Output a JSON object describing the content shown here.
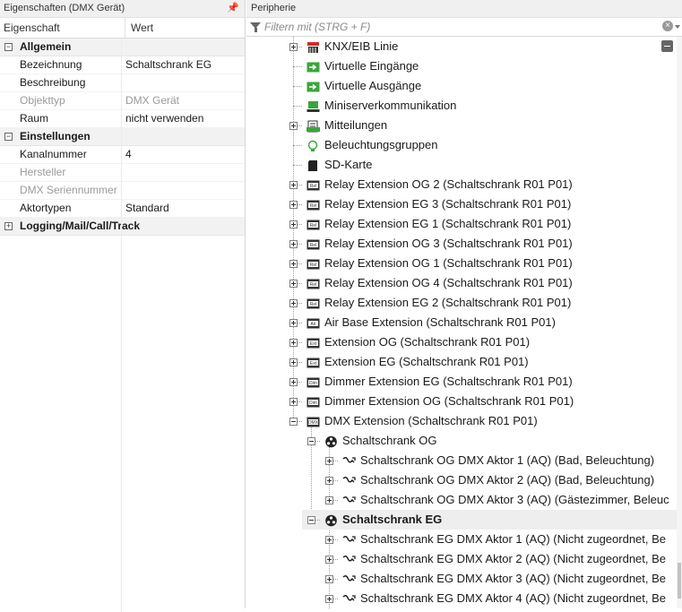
{
  "left_panel": {
    "title": "Eigenschaften (DMX Gerät)",
    "pin_glyph": "📌",
    "header": {
      "col1": "Eigenschaft",
      "col2": "Wert"
    },
    "categories": [
      {
        "label": "Allgemein",
        "exp": "−"
      },
      {
        "label": "Einstellungen",
        "exp": "−"
      },
      {
        "label": "Logging/Mail/Call/Track",
        "exp": "+"
      }
    ],
    "rows": {
      "bezeichnung": {
        "label": "Bezeichnung",
        "value": "Schaltschrank EG"
      },
      "beschreibung": {
        "label": "Beschreibung",
        "value": ""
      },
      "objekttyp": {
        "label": "Objekttyp",
        "value": "DMX Gerät"
      },
      "raum": {
        "label": "Raum",
        "value": "nicht verwenden"
      },
      "kanalnummer": {
        "label": "Kanalnummer",
        "value": "4"
      },
      "hersteller": {
        "label": "Hersteller",
        "value": ""
      },
      "seriennummer": {
        "label": "DMX Seriennummer",
        "value": ""
      },
      "aktortypen": {
        "label": "Aktortypen",
        "value": "Standard"
      }
    }
  },
  "right_panel": {
    "title": "Peripherie",
    "filter_placeholder": "Filtern mit (STRG + F)",
    "tree": [
      {
        "label": "KNX/EIB Linie",
        "icon": "knx-icon"
      },
      {
        "label": "Virtuelle Eingänge",
        "icon": "virtual-input-icon"
      },
      {
        "label": "Virtuelle Ausgänge",
        "icon": "virtual-output-icon"
      },
      {
        "label": "Miniserverkommunikation",
        "icon": "miniserver-icon"
      },
      {
        "label": "Mitteilungen",
        "icon": "messages-icon"
      },
      {
        "label": "Beleuchtungsgruppen",
        "icon": "lightbulb-icon"
      },
      {
        "label": "SD-Karte",
        "icon": "sdcard-icon"
      },
      {
        "label": "Relay Extension OG 2 (Schaltschrank R01 P01)",
        "icon": "relay-extension-icon",
        "badge": "Rel"
      },
      {
        "label": "Relay Extension EG 3 (Schaltschrank R01 P01)",
        "icon": "relay-extension-icon",
        "badge": "Rel"
      },
      {
        "label": "Relay Extension EG 1 (Schaltschrank R01 P01)",
        "icon": "relay-extension-icon",
        "badge": "Rel"
      },
      {
        "label": "Relay Extension OG 3 (Schaltschrank R01 P01)",
        "icon": "relay-extension-icon",
        "badge": "Rel"
      },
      {
        "label": "Relay Extension OG 1 (Schaltschrank R01 P01)",
        "icon": "relay-extension-icon",
        "badge": "Rel"
      },
      {
        "label": "Relay Extension OG 4 (Schaltschrank R01 P01)",
        "icon": "relay-extension-icon",
        "badge": "Rel"
      },
      {
        "label": "Relay Extension EG 2 (Schaltschrank R01 P01)",
        "icon": "relay-extension-icon",
        "badge": "Rel"
      },
      {
        "label": "Air Base Extension (Schaltschrank R01 P01)",
        "icon": "air-base-icon",
        "badge": "Air"
      },
      {
        "label": "Extension OG (Schaltschrank R01 P01)",
        "icon": "extension-icon",
        "badge": "Ext"
      },
      {
        "label": "Extension EG (Schaltschrank R01 P01)",
        "icon": "extension-icon",
        "badge": "Ext"
      },
      {
        "label": "Dimmer Extension EG (Schaltschrank R01 P01)",
        "icon": "dimmer-extension-icon",
        "badge": "Dim"
      },
      {
        "label": "Dimmer Extension OG (Schaltschrank R01 P01)",
        "icon": "dimmer-extension-icon",
        "badge": "Dim"
      },
      {
        "label": "DMX Extension (Schaltschrank R01 P01)",
        "icon": "dmx-extension-icon",
        "badge": "DMX"
      },
      {
        "label": "Schaltschrank OG",
        "icon": "dmx-device-icon"
      },
      {
        "label": "Schaltschrank OG DMX Aktor 1 (AQ) (Bad, Beleuchtung)",
        "icon": "dmx-actuator-icon"
      },
      {
        "label": "Schaltschrank OG DMX Aktor 2 (AQ) (Bad, Beleuchtung)",
        "icon": "dmx-actuator-icon"
      },
      {
        "label": "Schaltschrank OG DMX Aktor 3 (AQ) (Gästezimmer, Beleuc",
        "icon": "dmx-actuator-icon"
      },
      {
        "label": "Schaltschrank EG",
        "icon": "dmx-device-icon"
      },
      {
        "label": "Schaltschrank EG DMX Aktor 1 (AQ) (Nicht zugeordnet, Be",
        "icon": "dmx-actuator-icon"
      },
      {
        "label": "Schaltschrank EG DMX Aktor 2 (AQ) (Nicht zugeordnet, Be",
        "icon": "dmx-actuator-icon"
      },
      {
        "label": "Schaltschrank EG DMX Aktor 3 (AQ) (Nicht zugeordnet, Be",
        "icon": "dmx-actuator-icon"
      },
      {
        "label": "Schaltschrank EG DMX Aktor 4 (AQ) (Nicht zugeordnet, Be",
        "icon": "dmx-actuator-icon"
      }
    ]
  },
  "colors": {
    "green_icon": "#3aa53a",
    "red_knx": "#d22b2b",
    "selected_row": "#eeeeee"
  }
}
